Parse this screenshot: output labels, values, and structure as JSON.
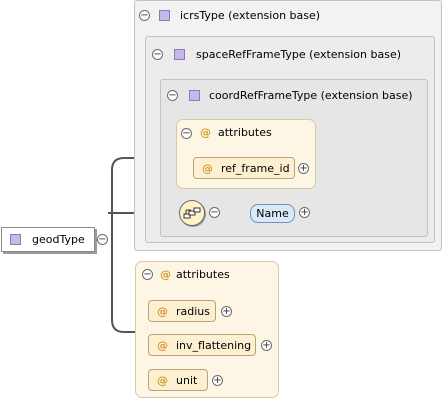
{
  "root": {
    "label": "geodType"
  },
  "ext_icrs": {
    "label": "icrsType (extension base)"
  },
  "ext_spaceref": {
    "label": "spaceRefFrameType (extension base)"
  },
  "ext_coordref": {
    "label": "coordRefFrameType (extension base)"
  },
  "inner_attributes": {
    "header": "attributes",
    "items": [
      {
        "label": "ref_frame_id"
      }
    ]
  },
  "sequence": {
    "element": "Name"
  },
  "geod_attributes": {
    "header": "attributes",
    "items": [
      {
        "label": "radius"
      },
      {
        "label": "inv_flattening"
      },
      {
        "label": "unit"
      }
    ]
  },
  "symbols": {
    "at": "@",
    "collapse": "−",
    "expand": "+"
  }
}
